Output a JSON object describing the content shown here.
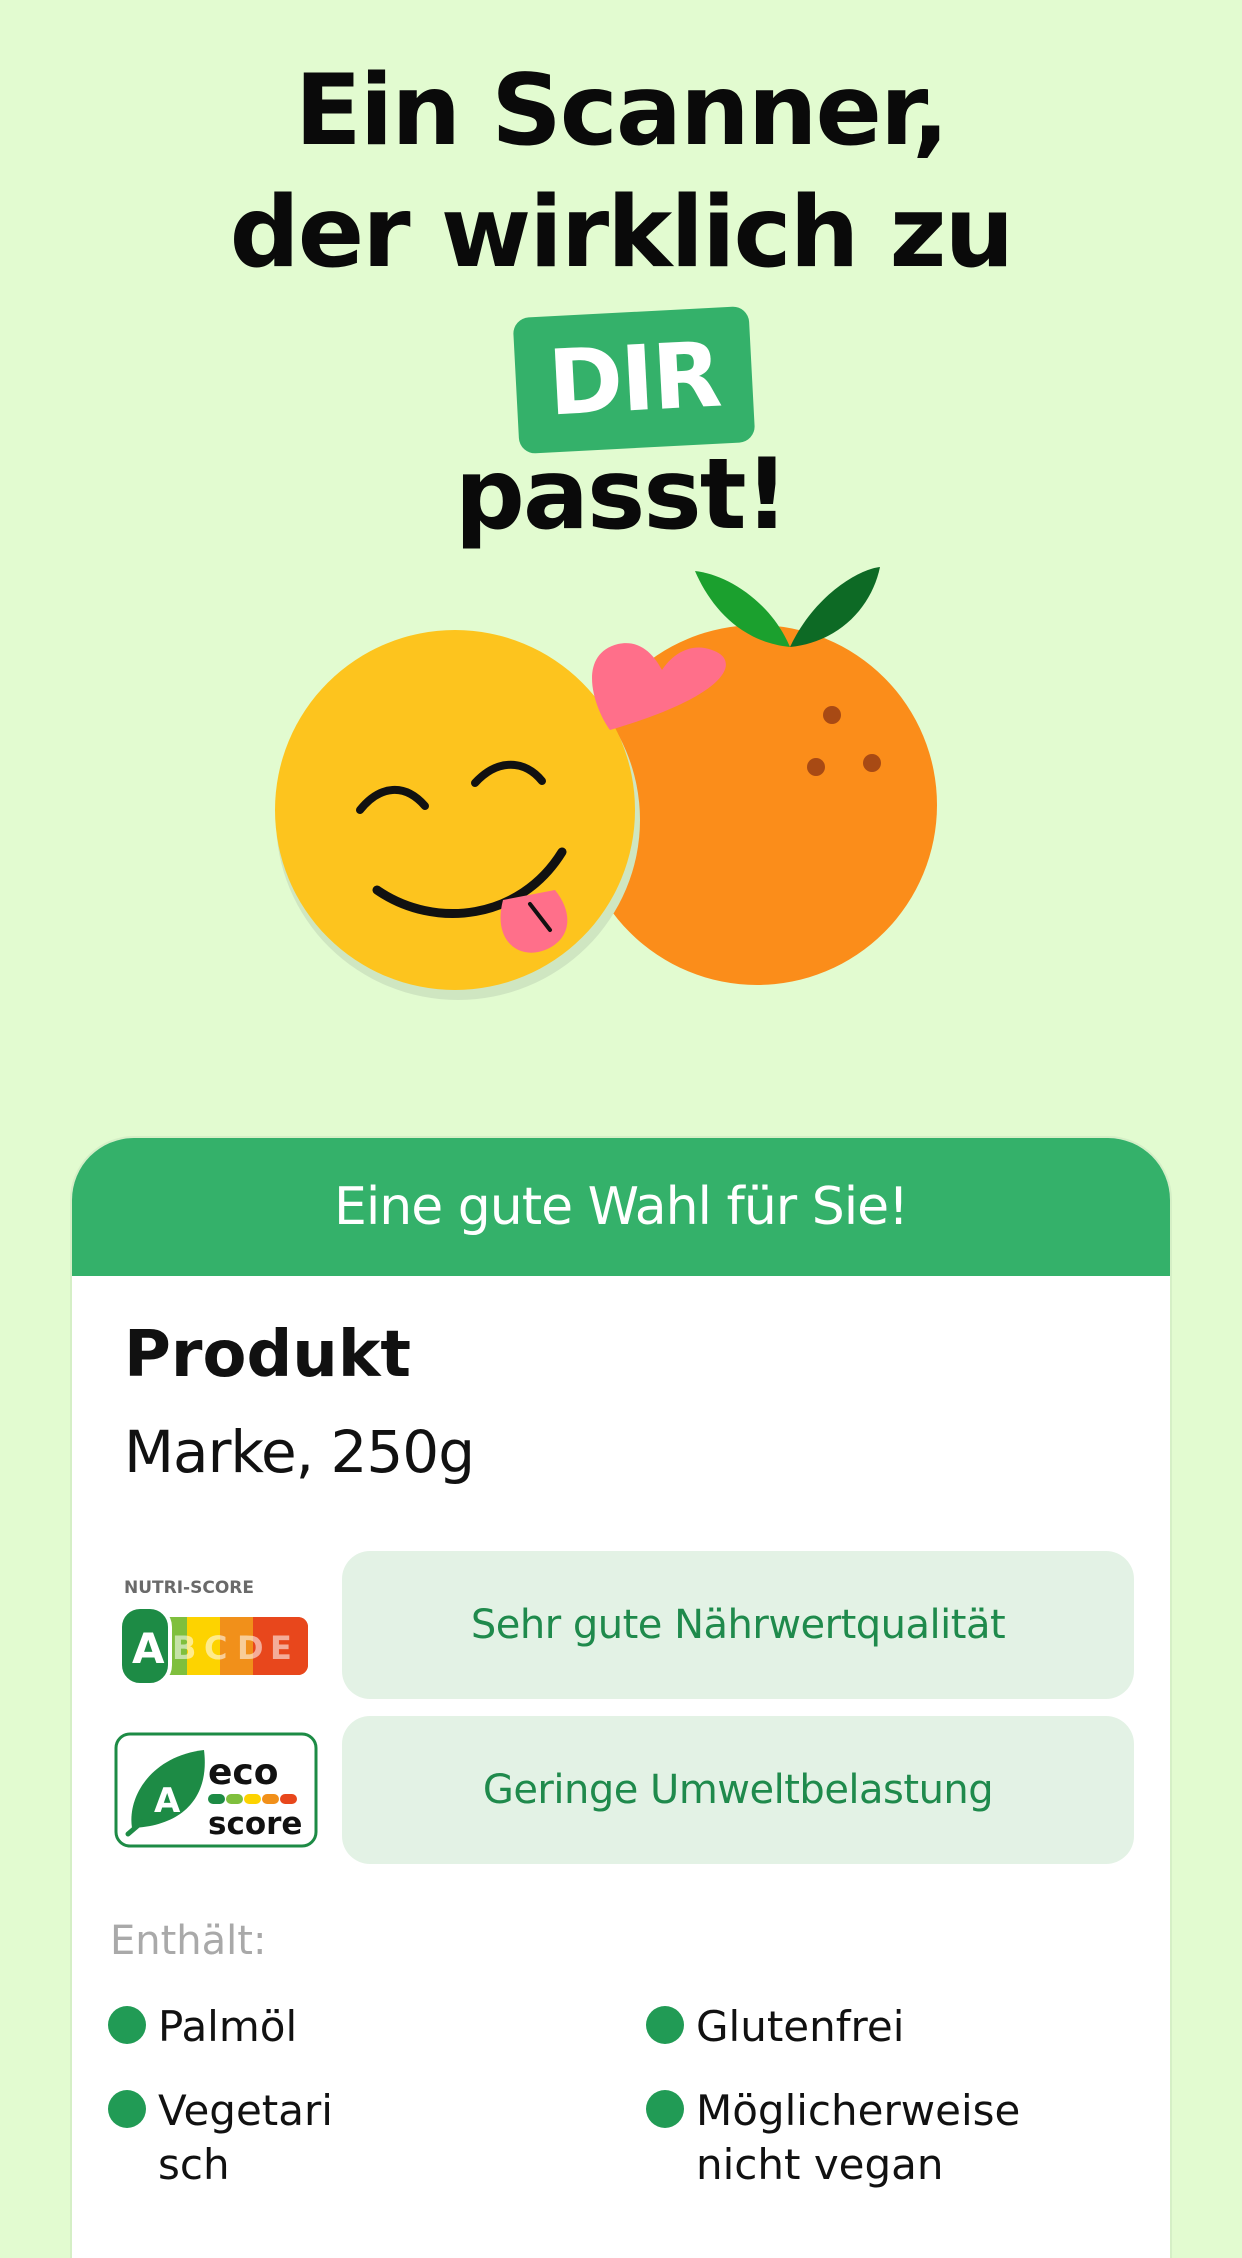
{
  "headline": {
    "line1": "Ein Scanner,",
    "line2": "der wirklich zu",
    "highlight": "DIR",
    "line3": "passt!"
  },
  "card": {
    "header": "Eine gute Wahl für Sie!",
    "product_name": "Produkt",
    "product_detail": "Marke, 250g",
    "nutri_score": {
      "label": "NUTRI-SCORE",
      "grades": [
        "A",
        "B",
        "C",
        "D",
        "E"
      ],
      "selected": "A",
      "description": "Sehr gute Nährwertqualität"
    },
    "eco_score": {
      "grade": "A",
      "word1": "eco",
      "word2": "score",
      "description": "Geringe Umweltbelastung"
    },
    "contains_label": "Enthält:",
    "tags": [
      "Palmöl",
      "Glutenfrei",
      "Vegetari\nsch",
      "Möglicherweise\nnicht vegan"
    ]
  },
  "colors": {
    "background": "#e2fbd0",
    "brand_green": "#34b16a",
    "pill_bg": "#e3f2e5",
    "pill_text": "#1f8a4c",
    "tag_dot": "#219b55"
  },
  "icons": [
    "smiley-face-icon",
    "orange-fruit-icon",
    "heart-icon",
    "leaf-icon"
  ]
}
